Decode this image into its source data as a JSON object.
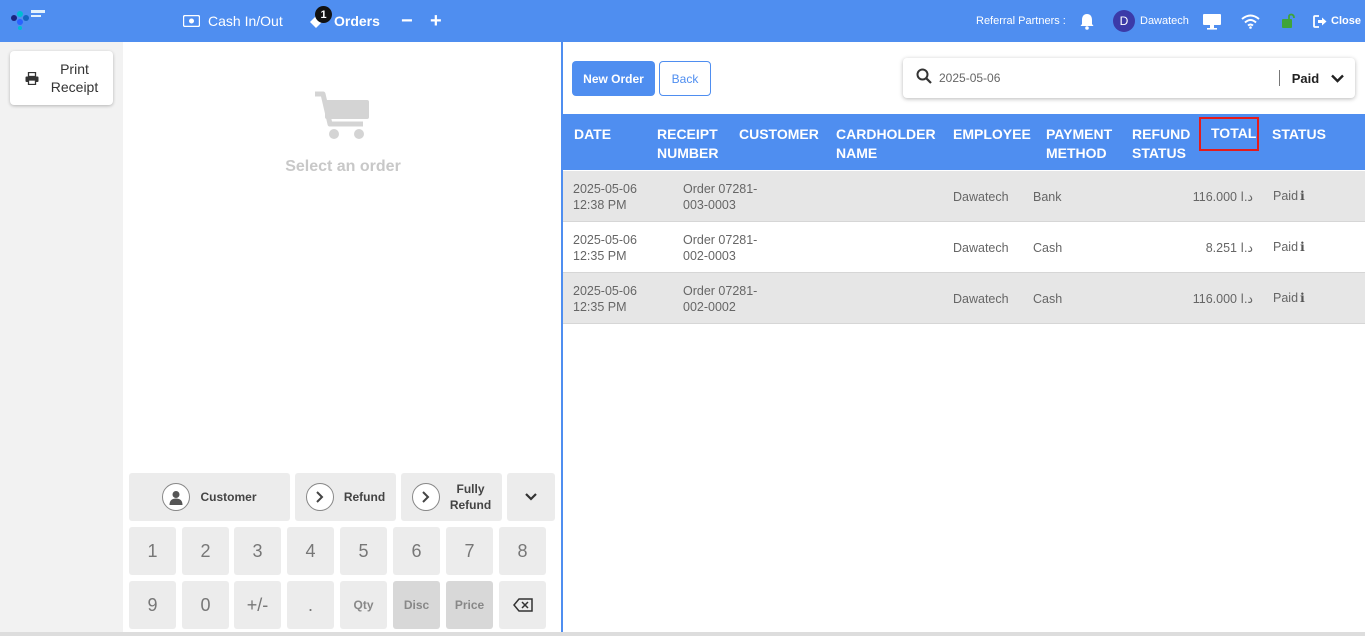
{
  "topbar": {
    "cash_label": "Cash In/Out",
    "orders_label": "Orders",
    "orders_badge": "1",
    "minus": "−",
    "plus": "+",
    "referral_label": "Referral Partners :",
    "user_initial": "D",
    "user_name": "Dawatech",
    "close_label": "Close",
    "colors": {
      "bar": "#4f8ef0",
      "lock": "#3fa43a"
    }
  },
  "left": {
    "print_label_1": "Print",
    "print_label_2": "Receipt"
  },
  "middle": {
    "empty_text": "Select an order",
    "actions": {
      "customer": "Customer",
      "refund": "Refund",
      "fully_refund_1": "Fully",
      "fully_refund_2": "Refund"
    },
    "keys": [
      "1",
      "2",
      "3",
      "4",
      "5",
      "6",
      "7",
      "8",
      "9",
      "0",
      "+/-",
      ".",
      "Qty",
      "Disc",
      "Price"
    ]
  },
  "right": {
    "new_order": "New Order",
    "back": "Back",
    "search_value": "2025-05-06",
    "status_filter": "Paid",
    "columns": {
      "date": "DATE",
      "receipt_1": "RECEIPT",
      "receipt_2": "NUMBER",
      "customer": "CUSTOMER",
      "cardholder_1": "CARDHOLDER",
      "cardholder_2": "NAME",
      "employee": "EMPLOYEE",
      "payment_1": "PAYMENT",
      "payment_2": "METHOD",
      "refund_1": "REFUND",
      "refund_2": "STATUS",
      "total": "TOTAL",
      "status": "STATUS"
    },
    "rows": [
      {
        "date": "2025-05-06",
        "time": "12:38 PM",
        "receipt_1": "Order 07281-",
        "receipt_2": "003-0003",
        "employee": "Dawatech",
        "payment": "Bank",
        "total": "116.000 د.ا",
        "status": "Paid"
      },
      {
        "date": "2025-05-06",
        "time": "12:35 PM",
        "receipt_1": "Order 07281-",
        "receipt_2": "002-0003",
        "employee": "Dawatech",
        "payment": "Cash",
        "total": "8.251 د.ا",
        "status": "Paid"
      },
      {
        "date": "2025-05-06",
        "time": "12:35 PM",
        "receipt_1": "Order 07281-",
        "receipt_2": "002-0002",
        "employee": "Dawatech",
        "payment": "Cash",
        "total": "116.000 د.ا",
        "status": "Paid"
      }
    ]
  }
}
